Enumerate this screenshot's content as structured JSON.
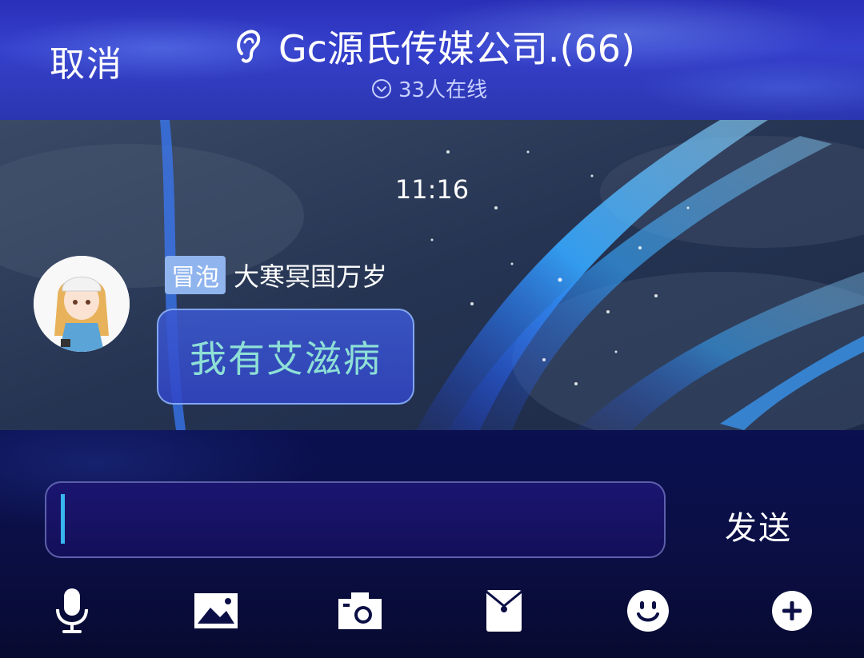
{
  "header": {
    "cancel_label": "取消",
    "ear_icon": "ear-icon",
    "title": "Gc源氏传媒公司.(66)",
    "online_text": "33人在线",
    "online_icon": "chevron-down-circle-icon"
  },
  "chat": {
    "timestamp": "11:16",
    "messages": [
      {
        "tag": "冒泡",
        "sender": "大寒冥国万岁",
        "text": "我有艾滋病",
        "avatar": "anime-girl-avatar"
      }
    ]
  },
  "composer": {
    "input_value": "",
    "send_label": "发送"
  },
  "toolbar": {
    "icons": [
      "microphone-icon",
      "image-icon",
      "camera-icon",
      "red-packet-icon",
      "emoji-icon",
      "plus-icon"
    ]
  },
  "colors": {
    "header_bg": "#2f3ac0",
    "bubble_text": "#8ee0d6",
    "tag_bg": "#8fb4ee",
    "cursor": "#38b6f0",
    "bottom_bg": "#0b0f45"
  }
}
